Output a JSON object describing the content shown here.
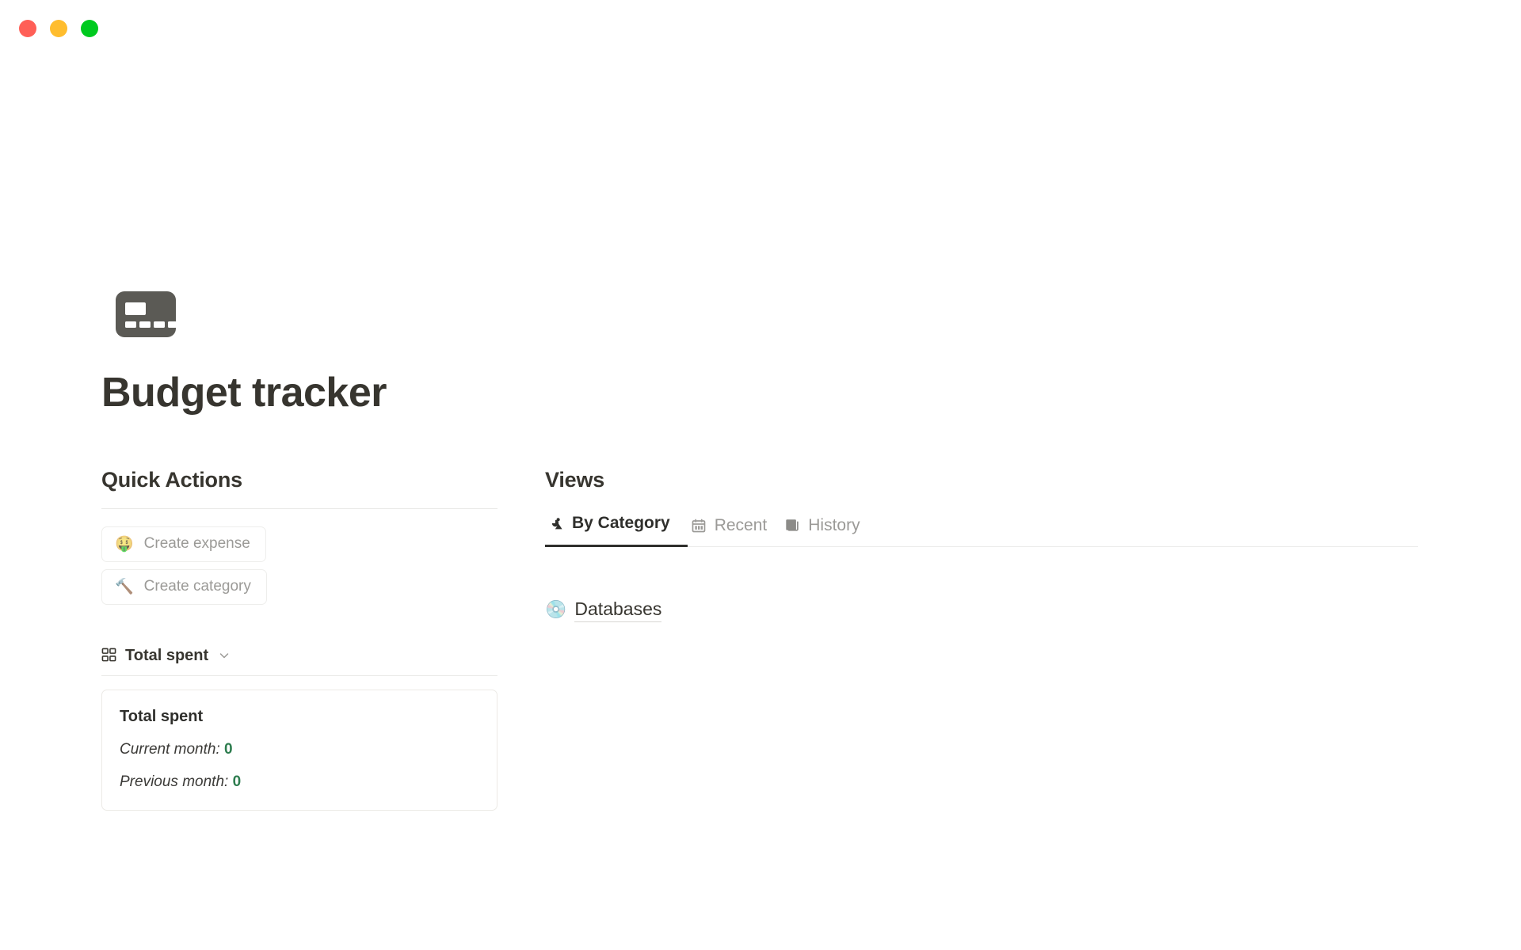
{
  "window": {
    "controls": [
      {
        "name": "close",
        "color": "#ff5f57"
      },
      {
        "name": "minimize",
        "color": "#ffbd2e"
      },
      {
        "name": "maximize",
        "color": "#00ca1f"
      }
    ]
  },
  "page": {
    "icon": "credit-card-icon",
    "title": "Budget tracker"
  },
  "quick_actions": {
    "heading": "Quick Actions",
    "buttons": [
      {
        "emoji": "🤑",
        "icon_name": "money-mouth-face-emoji",
        "label": "Create expense"
      },
      {
        "emoji": "🔨",
        "icon_name": "hammer-emoji",
        "label": "Create category"
      }
    ]
  },
  "total_spent": {
    "header_label": "Total spent",
    "header_icon": "grid-icon",
    "chevron_icon": "chevron-down-icon",
    "card": {
      "title": "Total spent",
      "rows": [
        {
          "label": "Current month:",
          "value": "0"
        },
        {
          "label": "Previous month:",
          "value": "0"
        }
      ]
    },
    "value_color": "#2e7d4f"
  },
  "views": {
    "heading": "Views",
    "tabs": [
      {
        "label": "By Category",
        "icon": "shapes-icon",
        "active": true
      },
      {
        "label": "Recent",
        "icon": "calendar-icon",
        "active": false
      },
      {
        "label": "History",
        "icon": "copy-pages-icon",
        "active": false
      }
    ],
    "content": {
      "link_emoji": "💿",
      "link_icon_name": "optical-disc-emoji",
      "link_label": "Databases"
    }
  }
}
